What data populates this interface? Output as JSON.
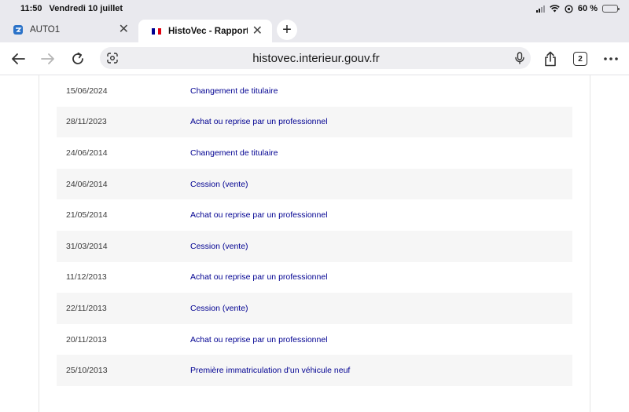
{
  "status_bar": {
    "time": "11:50",
    "date": "Vendredi 10 juillet",
    "battery": "60 %",
    "battery_level": 0.6
  },
  "tabs": [
    {
      "label": "AUTO1",
      "favicon": "auto1-logo-icon",
      "active": false
    },
    {
      "label": "HistoVec - Rapport vendeur",
      "favicon": "french-flag-icon",
      "active": true
    }
  ],
  "toolbar": {
    "url": "histovec.interieur.gouv.fr",
    "tab_count": "2"
  },
  "history": {
    "rows": [
      {
        "date": "15/06/2024",
        "event": "Changement de titulaire"
      },
      {
        "date": "28/11/2023",
        "event": "Achat ou reprise par un professionnel"
      },
      {
        "date": "24/06/2014",
        "event": "Changement de titulaire"
      },
      {
        "date": "24/06/2014",
        "event": "Cession (vente)"
      },
      {
        "date": "21/05/2014",
        "event": "Achat ou reprise par un professionnel"
      },
      {
        "date": "31/03/2014",
        "event": "Cession (vente)"
      },
      {
        "date": "11/12/2013",
        "event": "Achat ou reprise par un professionnel"
      },
      {
        "date": "22/11/2013",
        "event": "Cession (vente)"
      },
      {
        "date": "20/11/2013",
        "event": "Achat ou reprise par un professionnel"
      },
      {
        "date": "25/10/2013",
        "event": "Première immatriculation d'un véhicule neuf"
      }
    ]
  },
  "colors": {
    "link_blue": "#000091",
    "row_alt": "#f6f6f6",
    "chrome_bg": "#e9e9ee"
  }
}
